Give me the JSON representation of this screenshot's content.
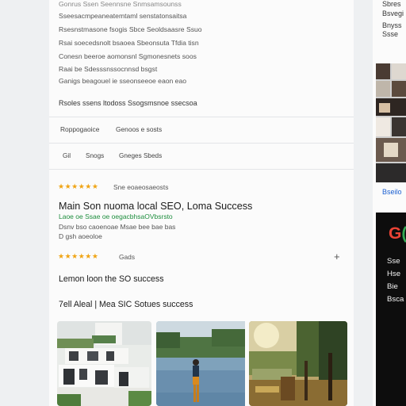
{
  "results_top": {
    "lines": [
      "Gonrus Ssen Seennsne Snmsamsounss",
      "Sseesacmpeaneatemtaml senstatonsaitsa",
      "Rsesnstmasone fsogis Sbce Seoldsaasre Ssuo",
      "Rsai soecedsnolt bsaoea Sbeonsuta Tfdia tisn",
      "Conesn beeroe aomonsnl Sgmonesnets soos",
      "Raai be Sdesssnssocnnsd bsgst",
      "Ganigs beagouel ie sseonseeoe eaon eao"
    ],
    "related_label": "Rsoles ssens ltodoss Ssogsmsnoe ssecsoa"
  },
  "filters": [
    "Roppogaoice",
    "Genoos e sosts"
  ],
  "chips": [
    "Gil",
    "Snogs",
    "Gneges Sbeds"
  ],
  "rating_1": {
    "stars": "★★★★★★",
    "text": "Sne eoaeosaeosts"
  },
  "result": {
    "title": "Main Son nuoma local SEO, Loma Success",
    "url": "Laoe oe Ssae oe oegacbhsaOVbsrsto",
    "desc_1": "Dsnv bso caoenoae Msae bee bae bas",
    "desc_2": "D gsh aoeoloe"
  },
  "rating_2": {
    "stars": "★★★★★★",
    "text": "Gads"
  },
  "plus_glyph": "+",
  "heading_1": "Lemon loon the SO success",
  "heading_2": "7ell Aleal | Mea SIC Sotues success",
  "side": {
    "lines": [
      "Sbres",
      "Bsvegi",
      "Bnyss",
      "Ssse"
    ],
    "link": "Bseilo"
  },
  "promo": {
    "logo_g": "G",
    "logo_rest": "(",
    "lines": [
      "Sse",
      "Hse",
      "Bie",
      "Bsca"
    ]
  },
  "colors": {
    "star": "#f0a414",
    "url_green": "#1e8e3e",
    "link_blue": "#1a5fd1"
  }
}
